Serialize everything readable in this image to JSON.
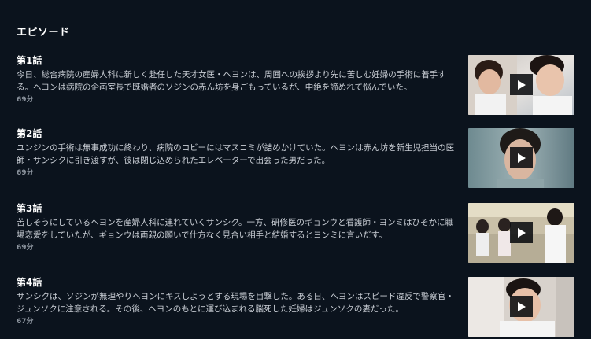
{
  "section": {
    "title": "エピソード"
  },
  "episodes": [
    {
      "title": "第1話",
      "description": "今日、総合病院の産婦人科に新しく赴任した天才女医・ヘヨンは、周囲への挨拶より先に苦しむ妊婦の手術に着手する。ヘヨンは病院の企画室長で既婚者のソジンの赤ん坊を身ごもっているが、中絶を諦めれて悩んでいた。",
      "duration": "69分",
      "thumbnail_icon": "play-icon"
    },
    {
      "title": "第2話",
      "description": "ユンジンの手術は無事成功に終わり、病院のロビーにはマスコミが詰めかけていた。ヘヨンは赤ん坊を新生児担当の医師・サンシクに引き渡すが、彼は閉じ込められたエレベーターで出会った男だった。",
      "duration": "69分",
      "thumbnail_icon": "play-icon"
    },
    {
      "title": "第3話",
      "description": "苦しそうにしているヘヨンを産婦人科に連れていくサンシク。一方、研修医のギョンウと看護師・ヨンミはひそかに職場恋愛をしていたが、ギョンウは両親の願いで仕方なく見合い相手と結婚するとヨンミに言いだす。",
      "duration": "69分",
      "thumbnail_icon": "play-icon"
    },
    {
      "title": "第4話",
      "description": "サンシクは、ソジンが無理やりヘヨンにキスしようとする現場を目撃した。ある日、ヘヨンはスピード違反で警察官・ジュンソクに注意される。その後、ヘヨンのもとに運び込まれる脳死した妊婦はジュンソクの妻だった。",
      "duration": "67分",
      "thumbnail_icon": "play-icon"
    }
  ]
}
